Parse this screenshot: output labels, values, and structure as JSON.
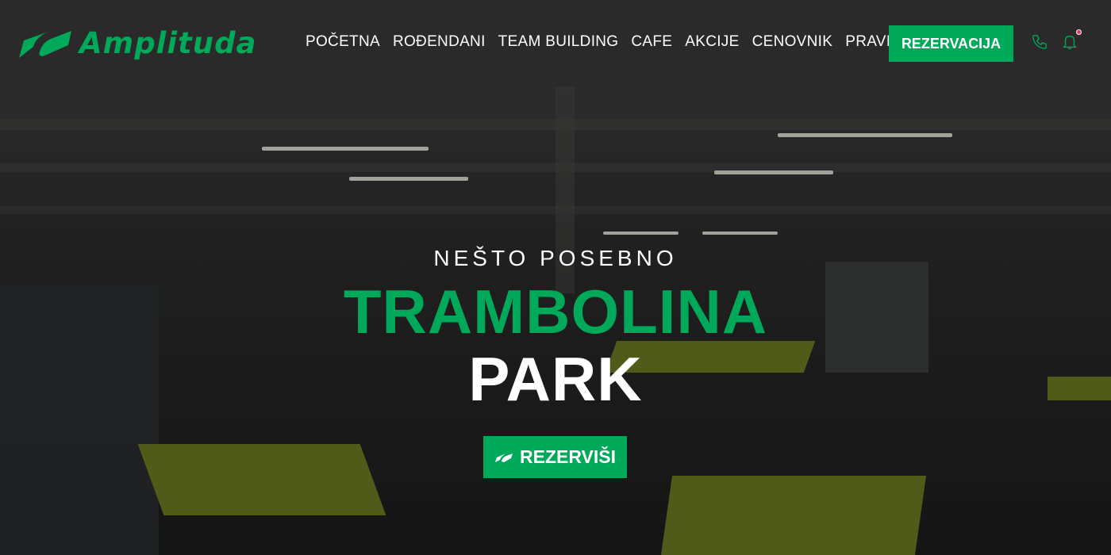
{
  "header": {
    "logo_text": "Amplituda",
    "nav": [
      "POČETNA",
      "ROĐENDANI",
      "TEAM BUILDING",
      "CAFE",
      "AKCIJE",
      "CENOVNIK",
      "PRAVILA"
    ],
    "cta": "REZERVACIJA",
    "icons": [
      "phone-icon",
      "bell-icon"
    ]
  },
  "hero": {
    "kicker": "NEŠTO POSEBNO",
    "title_line1": "TRAMBOLINA",
    "title_line2": "PARK",
    "button": "REZERVIŠI"
  },
  "colors": {
    "accent": "#00a859",
    "header_bg": "#2a2a2a",
    "notification": "#e53950"
  }
}
